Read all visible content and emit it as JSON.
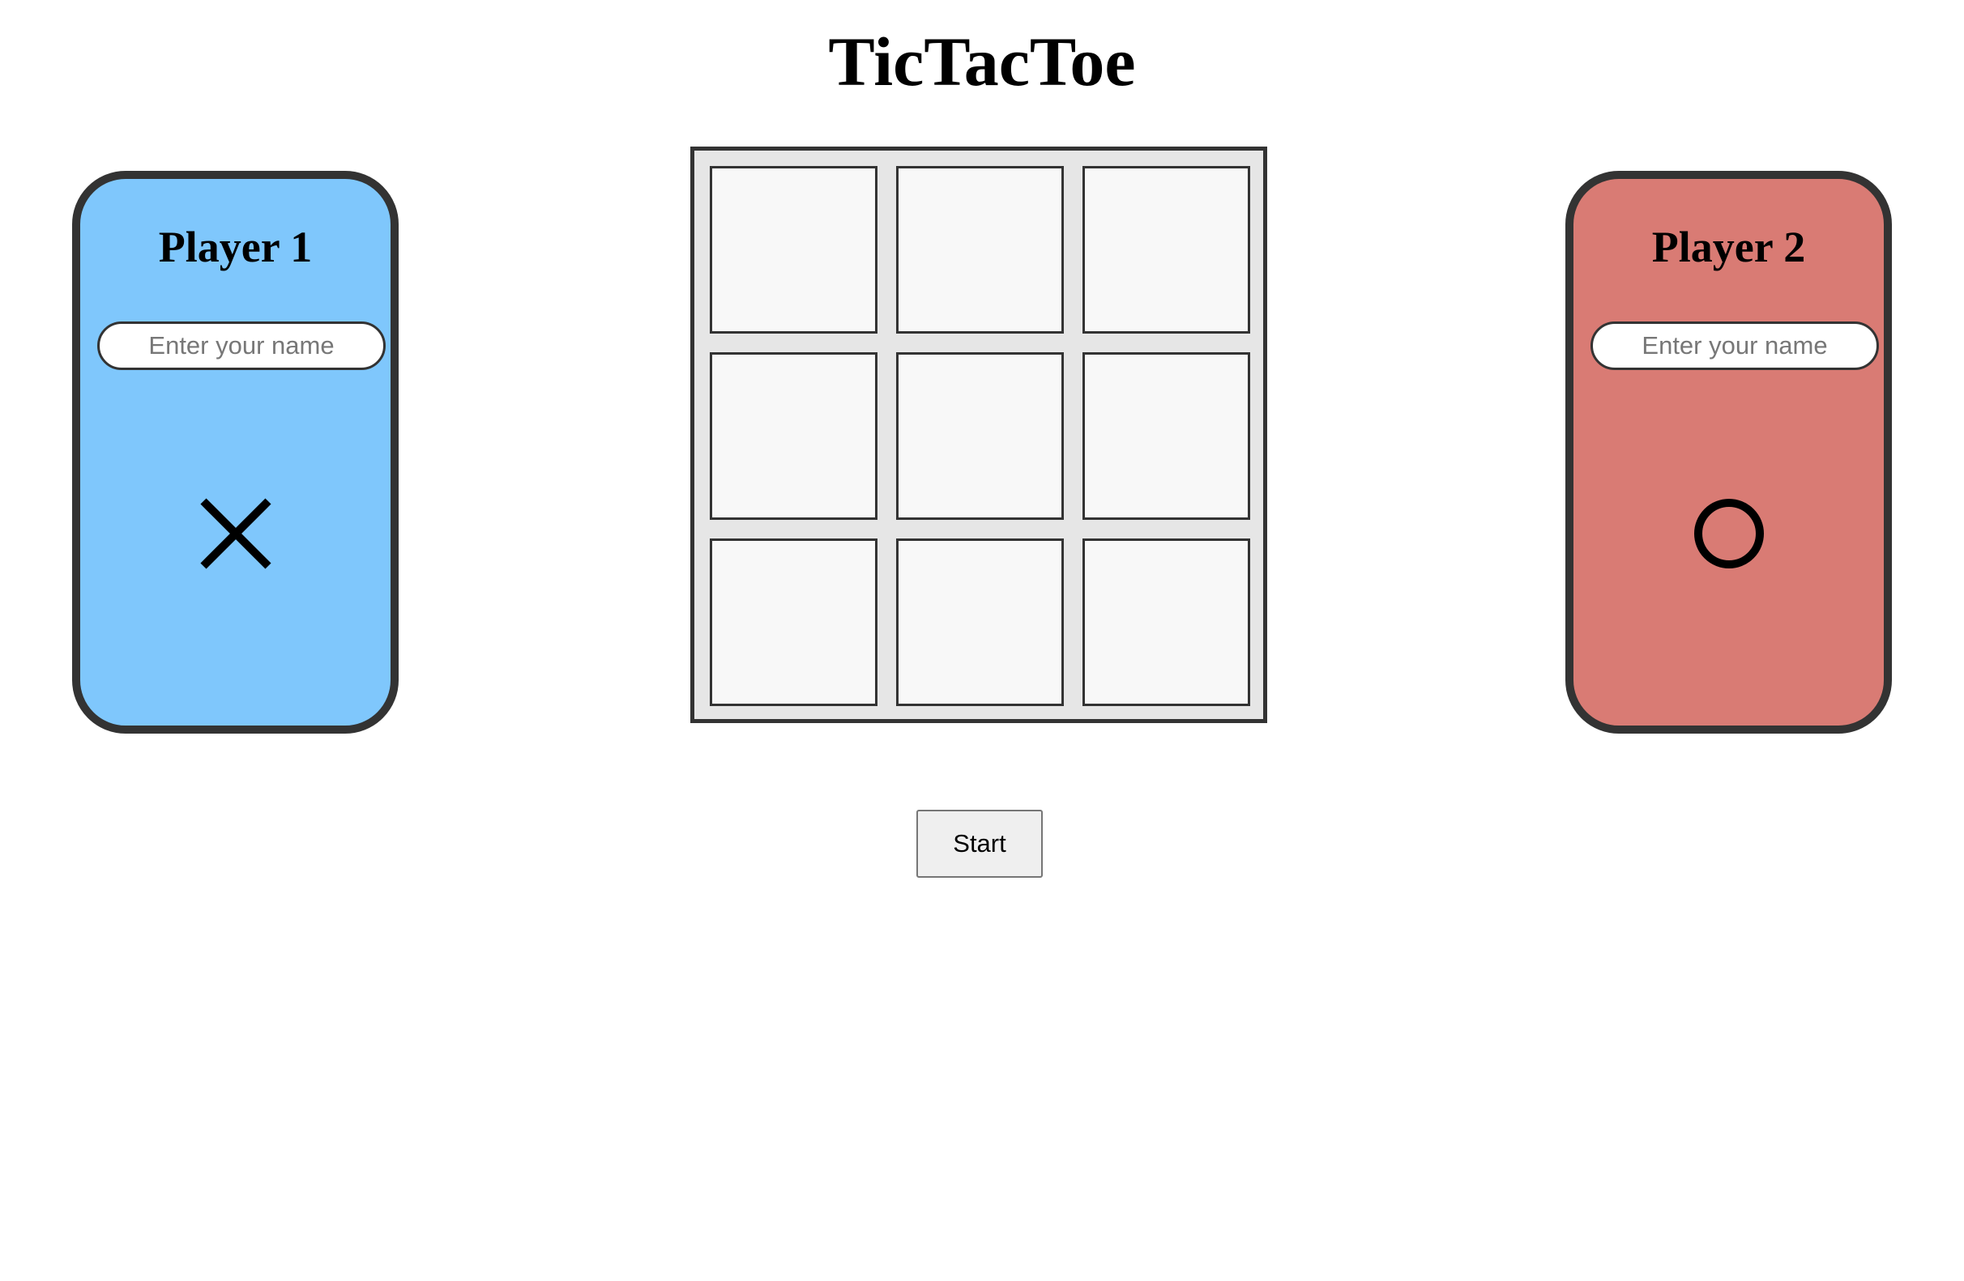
{
  "page": {
    "title": "TicTacToe"
  },
  "players": [
    {
      "label": "Player 1",
      "name_placeholder": "Enter your name",
      "name_value": "",
      "symbol": "x-icon",
      "card_color": "#7fc7fc"
    },
    {
      "label": "Player 2",
      "name_placeholder": "Enter your name",
      "name_value": "",
      "symbol": "o-icon",
      "card_color": "#d97b74"
    }
  ],
  "board": {
    "cells": [
      "",
      "",
      "",
      "",
      "",
      "",
      "",
      "",
      ""
    ]
  },
  "controls": {
    "start_label": "Start"
  },
  "colors": {
    "border": "#333333",
    "board_bg": "#e6e6e6",
    "cell_bg": "#f8f8f8"
  }
}
